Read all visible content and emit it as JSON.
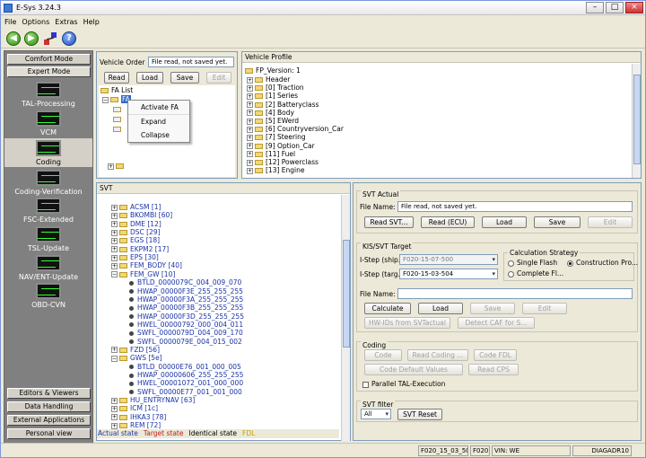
{
  "window": {
    "title": "E-Sys 3.24.3"
  },
  "menu": [
    "File",
    "Options",
    "Extras",
    "Help"
  ],
  "nav": {
    "top_buttons": [
      "Comfort Mode",
      "Expert Mode"
    ],
    "items": [
      "TAL-Processing",
      "VCM",
      "Coding",
      "Coding-Verification",
      "FSC-Extended",
      "TSL-Update",
      "NAV/ENT-Update",
      "OBD-CVN"
    ],
    "bottom_buttons": [
      "Editors & Viewers",
      "Data Handling",
      "External Applications",
      "Personal view"
    ]
  },
  "vehicle_order": {
    "label": "Vehicle Order",
    "file_value": "File read, not saved yet.",
    "buttons": [
      "Read",
      "Load",
      "Save",
      "Edit"
    ],
    "tree_root": "FA List",
    "tree_child": "FA",
    "ctx_menu": [
      "Activate FA",
      "Expand",
      "Collapse"
    ]
  },
  "vehicle_profile": {
    "label": "Vehicle Profile",
    "root": "FP_Version: 1",
    "items": [
      "Header",
      "[0] Traction",
      "[1] Series",
      "[2] Batteryclass",
      "[4] Body",
      "[5] EWerd",
      "[6] Countryversion_Car",
      "[7] Steering",
      "[9] Option_Car",
      "[11] Fuel",
      "[12] Powerclass",
      "[13] Engine"
    ]
  },
  "svt": {
    "label": "SVT",
    "rows": [
      {
        "t": "ACSM [1]",
        "lvl": 1,
        "kind": "folder"
      },
      {
        "t": "BKOMBI [60]",
        "lvl": 1,
        "kind": "folder"
      },
      {
        "t": "DME [12]",
        "lvl": 1,
        "kind": "folder"
      },
      {
        "t": "DSC [29]",
        "lvl": 1,
        "kind": "folder"
      },
      {
        "t": "EGS [18]",
        "lvl": 1,
        "kind": "folder"
      },
      {
        "t": "EKPM2 [17]",
        "lvl": 1,
        "kind": "folder"
      },
      {
        "t": "EPS [30]",
        "lvl": 1,
        "kind": "folder"
      },
      {
        "t": "FEM_BODY [40]",
        "lvl": 1,
        "kind": "folder"
      },
      {
        "t": "FEM_GW [10]",
        "lvl": 1,
        "kind": "open"
      },
      {
        "t": "BTLD_0000079C_004_009_070",
        "lvl": 2,
        "kind": "dot"
      },
      {
        "t": "HWAP_00000F3E_255_255_255",
        "lvl": 2,
        "kind": "dot"
      },
      {
        "t": "HWAP_00000F3A_255_255_255",
        "lvl": 2,
        "kind": "dot"
      },
      {
        "t": "HWAP_00000F3B_255_255_255",
        "lvl": 2,
        "kind": "dot"
      },
      {
        "t": "HWAP_00000F3D_255_255_255",
        "lvl": 2,
        "kind": "dot"
      },
      {
        "t": "HWEL_00000792_000_004_011",
        "lvl": 2,
        "kind": "dot"
      },
      {
        "t": "SWFL_0000079D_004_009_170",
        "lvl": 2,
        "kind": "dot"
      },
      {
        "t": "SWFL_0000079E_004_015_002",
        "lvl": 2,
        "kind": "dot"
      },
      {
        "t": "FZD [56]",
        "lvl": 1,
        "kind": "folder"
      },
      {
        "t": "GWS [5e]",
        "lvl": 1,
        "kind": "open"
      },
      {
        "t": "BTLD_00000E76_001_000_005",
        "lvl": 2,
        "kind": "dot"
      },
      {
        "t": "HWAP_00000606_255_255_255",
        "lvl": 2,
        "kind": "dot"
      },
      {
        "t": "HWEL_00001072_001_000_000",
        "lvl": 2,
        "kind": "dot"
      },
      {
        "t": "SWFL_00000E77_001_001_000",
        "lvl": 2,
        "kind": "dot"
      },
      {
        "t": "HU_ENTRYNAV [63]",
        "lvl": 1,
        "kind": "folder"
      },
      {
        "t": "ICM [1c]",
        "lvl": 1,
        "kind": "folder"
      },
      {
        "t": "IHKA3 [78]",
        "lvl": 1,
        "kind": "folder"
      },
      {
        "t": "REM [72]",
        "lvl": 1,
        "kind": "folder"
      }
    ],
    "legend": [
      {
        "t": "Actual state",
        "c": "#1a33a8"
      },
      {
        "t": "Target state",
        "c": "#c02020"
      },
      {
        "t": "Identical state",
        "c": "#000000"
      },
      {
        "t": "FDL",
        "c": "#c8a000"
      }
    ]
  },
  "svt_actual": {
    "title": "SVT Actual",
    "file_label": "File Name:",
    "file_value": "File read, not saved yet.",
    "buttons": [
      "Read SVT...",
      "Read (ECU)",
      "Load",
      "Save",
      "Edit"
    ]
  },
  "kis": {
    "title": "KIS/SVT Target",
    "ishipment_label": "I-Step (ship...",
    "ishipment_value": "F020-15-07-500",
    "itarget_label": "I-Step (targ...",
    "itarget_value": "F020-15-03-504",
    "calc_title": "Calculation Strategy",
    "radios": [
      "Single Flash",
      "Construction Pro...",
      "Complete Fl..."
    ],
    "file_label": "File Name:",
    "buttons": [
      "Calculate",
      "Load",
      "Save",
      "Edit"
    ],
    "buttons2": [
      "HW-IDs from SVTactual",
      "Detect CAF for S..."
    ]
  },
  "coding": {
    "title": "Coding",
    "buttons": [
      "Code",
      "Read Coding ...",
      "Code FDL",
      "Code Default Values",
      "Read CPS"
    ],
    "checkbox": "Parallel TAL-Execution"
  },
  "svt_filter": {
    "title": "SVT filter",
    "select": "All",
    "button": "SVT Reset"
  },
  "status": {
    "istep": "F020_15_03_504",
    "series": "F020",
    "vin": "VIN: WE",
    "diag": "DIAGADR10"
  }
}
